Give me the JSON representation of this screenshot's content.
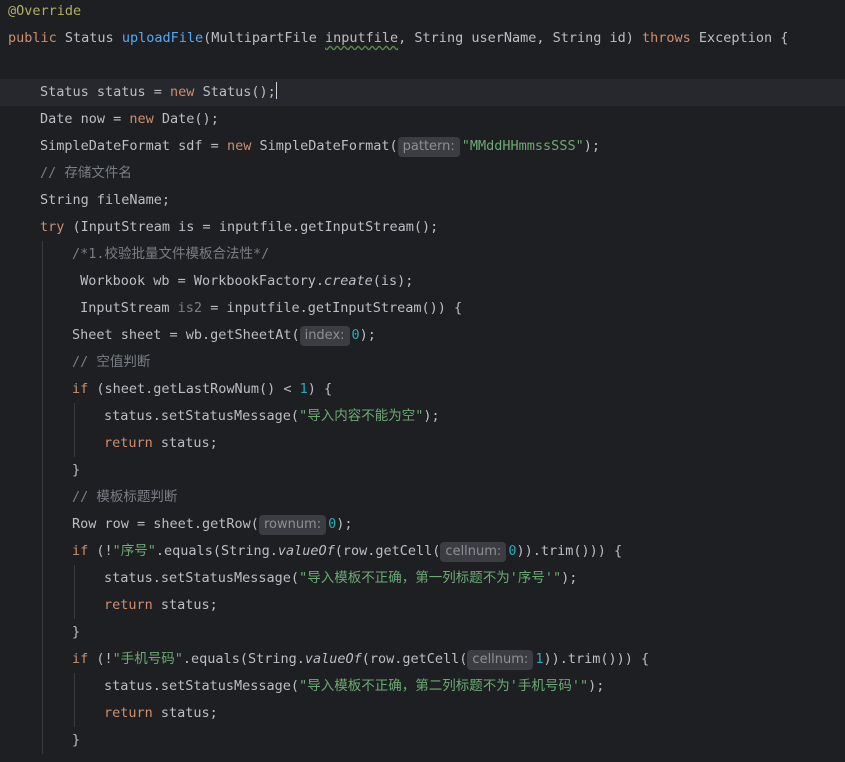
{
  "editor": {
    "lines": [
      {
        "indent": 0,
        "tokens": [
          {
            "t": "@Override",
            "c": "ann"
          }
        ]
      },
      {
        "indent": 0,
        "tokens": [
          {
            "t": "public ",
            "c": "kw"
          },
          {
            "t": "Status "
          },
          {
            "t": "uploadFile",
            "c": "fn"
          },
          {
            "t": "(MultipartFile "
          },
          {
            "t": "inputfile",
            "c": "underline"
          },
          {
            "t": ", String userName, String id) "
          },
          {
            "t": "throws ",
            "c": "kw"
          },
          {
            "t": "Exception {"
          }
        ]
      },
      {
        "indent": 0,
        "tokens": []
      },
      {
        "indent": 1,
        "current": true,
        "tokens": [
          {
            "t": "Status status = "
          },
          {
            "t": "new ",
            "c": "kw"
          },
          {
            "t": "Status();"
          },
          {
            "caret": true
          }
        ]
      },
      {
        "indent": 1,
        "tokens": [
          {
            "t": "Date now = "
          },
          {
            "t": "new ",
            "c": "kw"
          },
          {
            "t": "Date();"
          }
        ]
      },
      {
        "indent": 1,
        "tokens": [
          {
            "t": "SimpleDateFormat sdf = "
          },
          {
            "t": "new ",
            "c": "kw"
          },
          {
            "t": "SimpleDateFormat("
          },
          {
            "hint": "pattern:"
          },
          {
            "t": "\"MMddHHmmssSSS\"",
            "c": "str"
          },
          {
            "t": ");"
          }
        ]
      },
      {
        "indent": 1,
        "tokens": [
          {
            "t": "// 存储文件名",
            "c": "cmt"
          }
        ]
      },
      {
        "indent": 1,
        "tokens": [
          {
            "t": "String fileName;"
          }
        ]
      },
      {
        "indent": 1,
        "tokens": [
          {
            "t": "try ",
            "c": "kw"
          },
          {
            "t": "(InputStream is = inputfile.getInputStream();"
          }
        ]
      },
      {
        "indent": 2,
        "tokens": [
          {
            "t": "/*1.校验批量文件模板合法性*/",
            "c": "cmt"
          }
        ]
      },
      {
        "indent": 2,
        "tokens": [
          {
            "t": " Workbook wb = WorkbookFactory."
          },
          {
            "t": "create",
            "c": "ital"
          },
          {
            "t": "(is);"
          }
        ]
      },
      {
        "indent": 2,
        "tokens": [
          {
            "t": " InputStream "
          },
          {
            "t": "is2",
            "c": "unused"
          },
          {
            "t": " = inputfile.getInputStream()) {"
          }
        ]
      },
      {
        "indent": 2,
        "tokens": [
          {
            "t": "Sheet sheet = wb.getSheetAt("
          },
          {
            "hint": "index:"
          },
          {
            "t": "0",
            "c": "num"
          },
          {
            "t": ");"
          }
        ]
      },
      {
        "indent": 2,
        "tokens": [
          {
            "t": "// 空值判断",
            "c": "cmt"
          }
        ]
      },
      {
        "indent": 2,
        "tokens": [
          {
            "t": "if ",
            "c": "kw"
          },
          {
            "t": "(sheet.getLastRowNum() < "
          },
          {
            "t": "1",
            "c": "num"
          },
          {
            "t": ") {"
          }
        ]
      },
      {
        "indent": 3,
        "tokens": [
          {
            "t": "status.setStatusMessage("
          },
          {
            "t": "\"导入内容不能为空\"",
            "c": "str"
          },
          {
            "t": ");"
          }
        ]
      },
      {
        "indent": 3,
        "tokens": [
          {
            "t": "return ",
            "c": "kw"
          },
          {
            "t": "status;"
          }
        ]
      },
      {
        "indent": 2,
        "tokens": [
          {
            "t": "}"
          }
        ]
      },
      {
        "indent": 2,
        "tokens": [
          {
            "t": "// 模板标题判断",
            "c": "cmt"
          }
        ]
      },
      {
        "indent": 2,
        "tokens": [
          {
            "t": "Row row = sheet.getRow("
          },
          {
            "hint": "rownum:"
          },
          {
            "t": "0",
            "c": "num"
          },
          {
            "t": ");"
          }
        ]
      },
      {
        "indent": 2,
        "tokens": [
          {
            "t": "if ",
            "c": "kw"
          },
          {
            "t": "(!"
          },
          {
            "t": "\"序号\"",
            "c": "str"
          },
          {
            "t": ".equals(String."
          },
          {
            "t": "valueOf",
            "c": "ital"
          },
          {
            "t": "(row.getCell("
          },
          {
            "hint": "cellnum:"
          },
          {
            "t": "0",
            "c": "num"
          },
          {
            "t": ")).trim())) {"
          }
        ]
      },
      {
        "indent": 3,
        "tokens": [
          {
            "t": "status.setStatusMessage("
          },
          {
            "t": "\"导入模板不正确，第一列标题不为'序号'\"",
            "c": "str"
          },
          {
            "t": ");"
          }
        ]
      },
      {
        "indent": 3,
        "tokens": [
          {
            "t": "return ",
            "c": "kw"
          },
          {
            "t": "status;"
          }
        ]
      },
      {
        "indent": 2,
        "tokens": [
          {
            "t": "}"
          }
        ]
      },
      {
        "indent": 2,
        "tokens": [
          {
            "t": "if ",
            "c": "kw"
          },
          {
            "t": "(!"
          },
          {
            "t": "\"手机号码\"",
            "c": "str"
          },
          {
            "t": ".equals(String."
          },
          {
            "t": "valueOf",
            "c": "ital"
          },
          {
            "t": "(row.getCell("
          },
          {
            "hint": "cellnum:"
          },
          {
            "t": "1",
            "c": "num"
          },
          {
            "t": ")).trim())) {"
          }
        ]
      },
      {
        "indent": 3,
        "tokens": [
          {
            "t": "status.setStatusMessage("
          },
          {
            "t": "\"导入模板不正确，第二列标题不为'手机号码'\"",
            "c": "str"
          },
          {
            "t": ");"
          }
        ]
      },
      {
        "indent": 3,
        "tokens": [
          {
            "t": "return ",
            "c": "kw"
          },
          {
            "t": "status;"
          }
        ]
      },
      {
        "indent": 2,
        "tokens": [
          {
            "t": "}"
          }
        ]
      }
    ]
  }
}
